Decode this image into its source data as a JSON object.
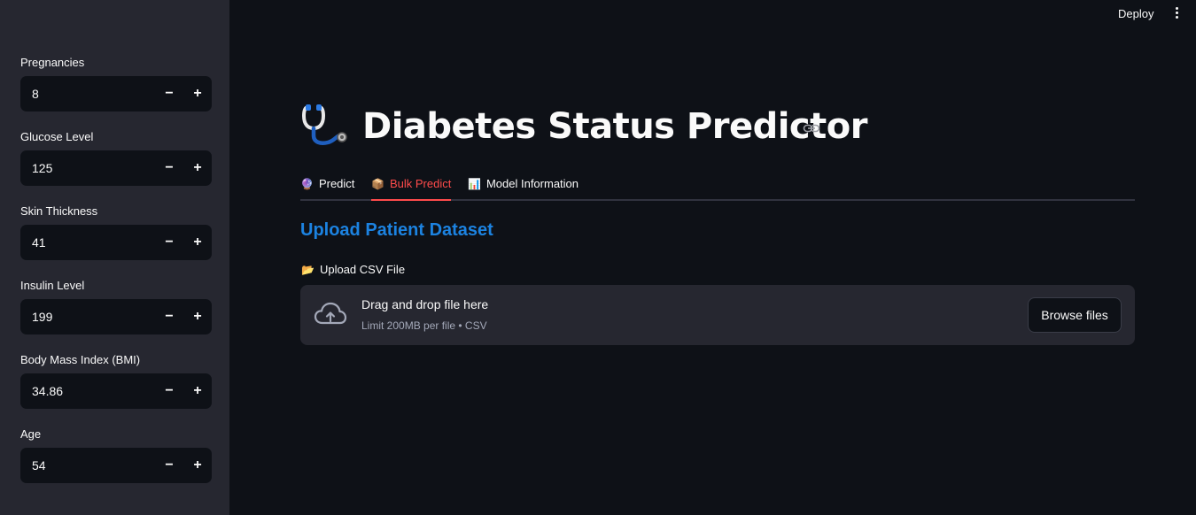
{
  "header": {
    "deploy_label": "Deploy",
    "menu_icon": "kebab-menu-icon"
  },
  "sidebar": {
    "fields": [
      {
        "label": "Pregnancies",
        "value": "8"
      },
      {
        "label": "Glucose Level",
        "value": "125"
      },
      {
        "label": "Skin Thickness",
        "value": "41"
      },
      {
        "label": "Insulin Level",
        "value": "199"
      },
      {
        "label": "Body Mass Index (BMI)",
        "value": "34.86"
      },
      {
        "label": "Age",
        "value": "54"
      }
    ],
    "minus": "−",
    "plus": "+"
  },
  "main": {
    "title": "Diabetes Status Predictor",
    "title_icon": "stethoscope-icon",
    "tabs": [
      {
        "emoji": "🔮",
        "label": "Predict",
        "active": false
      },
      {
        "emoji": "📦",
        "label": "Bulk Predict",
        "active": true
      },
      {
        "emoji": "📊",
        "label": "Model Information",
        "active": false
      }
    ],
    "section_title": "Upload Patient Dataset",
    "uploader": {
      "emoji": "📂",
      "label": "Upload CSV File",
      "drop_text": "Drag and drop file here",
      "limit_text": "Limit 200MB per file • CSV",
      "browse_label": "Browse files"
    }
  },
  "colors": {
    "background": "#0e1117",
    "sidebar": "#262730",
    "accent": "#ff4b4b",
    "section_title": "#1c83e1"
  }
}
